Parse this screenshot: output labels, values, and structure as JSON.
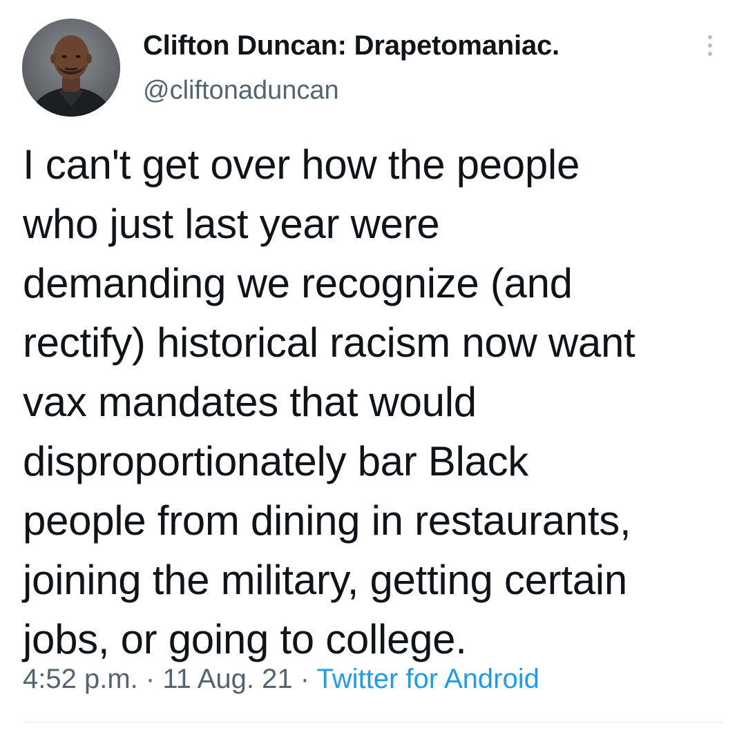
{
  "author": {
    "display_name": "Clifton Duncan: Drapetomaniac.",
    "handle": "@cliftonaduncan",
    "avatar_icon": "profile-photo"
  },
  "more_icon": "more-vertical-icon",
  "tweet": {
    "lines": [
      "I can't get over how the people",
      "who just last year were",
      "demanding we recognize (and",
      "rectify) historical racism now want",
      "vax mandates that would",
      "disproportionately bar Black",
      "people from dining in restaurants,",
      "joining the military, getting certain",
      "jobs, or going to college."
    ]
  },
  "meta": {
    "time": "4:52 p.m.",
    "separator": " · ",
    "date": "11 Aug. 21",
    "source": "Twitter for Android"
  },
  "colors": {
    "text": "#0f1419",
    "secondary": "#536471",
    "link": "#1d9bf0",
    "divider": "#eff3f4"
  }
}
